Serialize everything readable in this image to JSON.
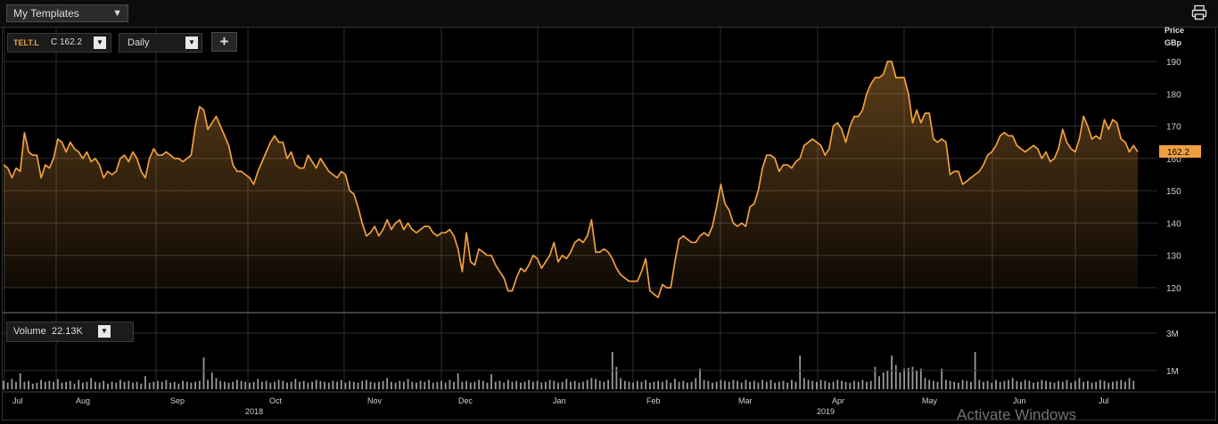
{
  "toolbar": {
    "template_label": "My Templates",
    "template_arrow": "▼"
  },
  "price_panel": {
    "symbol": "TELT.L",
    "close_label": "C 162.2",
    "interval": "Daily",
    "add_label": "+",
    "axis_title": "Price",
    "axis_unit": "GBp",
    "last_value_label": "162.2"
  },
  "volume_panel": {
    "label": "Volume",
    "value": "22.13K"
  },
  "colors": {
    "line": "#f0a040",
    "volume_bar": "#9a9a9a",
    "grid": "#2e2e2e",
    "background": "#000000",
    "badge": "#f0a040"
  },
  "watermark": "Activate Windows",
  "chart_data": [
    {
      "type": "area",
      "series": [
        {
          "x_start": "2018-07-02",
          "frequency": "daily",
          "values": [
            158,
            157,
            154,
            157,
            156,
            168,
            162,
            161,
            161,
            154,
            158,
            157,
            160,
            166,
            165,
            162,
            165,
            163,
            162,
            160,
            162,
            159,
            160,
            158,
            154,
            156,
            155,
            156,
            160,
            161,
            159,
            162,
            160,
            156,
            154,
            160,
            163,
            161,
            161,
            162,
            161,
            160,
            160,
            159,
            160,
            161,
            170,
            176,
            175,
            169,
            171,
            173,
            170,
            167,
            164,
            158,
            156,
            156,
            155,
            154,
            152,
            156,
            159,
            162,
            165,
            167,
            165,
            165,
            160,
            162,
            158,
            157,
            157,
            161,
            159,
            157,
            160,
            158,
            156,
            155,
            154,
            156,
            155,
            150,
            149,
            145,
            140,
            136,
            137,
            139,
            136,
            138,
            141,
            138,
            140,
            141,
            138,
            140,
            138,
            137,
            138,
            139,
            139,
            137,
            136,
            137,
            137,
            138,
            136,
            132,
            125,
            137,
            128,
            127,
            132,
            131,
            130,
            130,
            127,
            125,
            123,
            119,
            119,
            123,
            126,
            125,
            127,
            130,
            129,
            126,
            128,
            130,
            134,
            128,
            130,
            129,
            131,
            134,
            135,
            134,
            136,
            141,
            131,
            131,
            132,
            131,
            129,
            126,
            124,
            123,
            122,
            122,
            122,
            125,
            129,
            119,
            118,
            117,
            121,
            120,
            120,
            128,
            135,
            136,
            135,
            134,
            134,
            136,
            137,
            136,
            139,
            145,
            152,
            146,
            144,
            140,
            139,
            140,
            139,
            145,
            146,
            150,
            157,
            161,
            161,
            160,
            156,
            158,
            158,
            157,
            159,
            160,
            164,
            165,
            166,
            165,
            164,
            161,
            163,
            170,
            171,
            169,
            165,
            170,
            173,
            173,
            175,
            180,
            183,
            185,
            185,
            186,
            190,
            190,
            185,
            185,
            185,
            180,
            171,
            175,
            171,
            174,
            174,
            166,
            165,
            166,
            165,
            155,
            156,
            156,
            152,
            153,
            154,
            155,
            156,
            158,
            161,
            162,
            164,
            167,
            168,
            167,
            167,
            164,
            163,
            162,
            163,
            164,
            163,
            160,
            162,
            159,
            160,
            163,
            169,
            165,
            163,
            162,
            166,
            173,
            170,
            166,
            167,
            166,
            172,
            169,
            172,
            171,
            166,
            165,
            162,
            164,
            162
          ]
        }
      ],
      "xlabel": "",
      "ylabel": "Price GBp",
      "ylim": [
        113,
        200
      ],
      "yticks": [
        120,
        130,
        140,
        150,
        160,
        170,
        180,
        190
      ],
      "xticks": [
        "Jul",
        "Aug",
        "Sep",
        "Oct",
        "Nov",
        "Dec",
        "Jan",
        "Feb",
        "Mar",
        "Apr",
        "May",
        "Jun",
        "Jul"
      ],
      "year_labels": [
        "2018",
        "2019"
      ],
      "last_value": 162.2,
      "grid": true
    },
    {
      "type": "bar",
      "series": [
        {
          "name": "Volume",
          "values": [
            0.45,
            0.35,
            0.55,
            0.4,
            0.85,
            0.4,
            0.45,
            0.3,
            0.35,
            0.5,
            0.4,
            0.45,
            0.4,
            0.55,
            0.35,
            0.4,
            0.45,
            0.3,
            0.5,
            0.35,
            0.4,
            0.6,
            0.4,
            0.35,
            0.45,
            0.3,
            0.4,
            0.35,
            0.5,
            0.4,
            0.45,
            0.35,
            0.4,
            0.3,
            0.7,
            0.35,
            0.4,
            0.45,
            0.4,
            0.5,
            0.35,
            0.4,
            0.3,
            0.45,
            0.4,
            0.35,
            0.4,
            0.45,
            1.7,
            0.5,
            0.9,
            0.6,
            0.45,
            0.4,
            0.35,
            0.4,
            0.5,
            0.45,
            0.4,
            0.35,
            0.4,
            0.55,
            0.4,
            0.45,
            0.35,
            0.4,
            0.5,
            0.45,
            0.35,
            0.4,
            0.55,
            0.4,
            0.45,
            0.35,
            0.4,
            0.5,
            0.45,
            0.4,
            0.35,
            0.45,
            0.4,
            0.5,
            0.35,
            0.45,
            0.4,
            0.35,
            0.45,
            0.5,
            0.4,
            0.35,
            0.4,
            0.45,
            0.6,
            0.4,
            0.35,
            0.45,
            0.4,
            0.55,
            0.4,
            0.35,
            0.45,
            0.4,
            0.5,
            0.35,
            0.4,
            0.45,
            0.35,
            0.5,
            0.4,
            0.85,
            0.4,
            0.45,
            0.35,
            0.4,
            0.5,
            0.45,
            0.35,
            0.8,
            0.4,
            0.45,
            0.35,
            0.5,
            0.4,
            0.45,
            0.35,
            0.4,
            0.5,
            0.4,
            0.45,
            0.35,
            0.4,
            0.5,
            0.45,
            0.35,
            0.4,
            0.55,
            0.4,
            0.45,
            0.35,
            0.4,
            0.5,
            0.6,
            0.55,
            0.45,
            0.4,
            0.5,
            2.0,
            1.2,
            0.6,
            0.45,
            0.4,
            0.35,
            0.45,
            0.4,
            0.5,
            0.35,
            0.4,
            0.45,
            0.4,
            0.5,
            0.35,
            0.55,
            0.4,
            0.45,
            0.35,
            0.4,
            0.6,
            1.1,
            0.5,
            0.45,
            0.35,
            0.4,
            0.5,
            0.45,
            0.4,
            0.5,
            0.45,
            0.35,
            0.5,
            0.4,
            0.45,
            0.35,
            0.5,
            0.4,
            0.5,
            0.35,
            0.4,
            0.45,
            0.35,
            0.5,
            0.4,
            1.8,
            0.6,
            0.5,
            0.45,
            0.4,
            0.5,
            0.45,
            0.35,
            0.4,
            0.5,
            0.45,
            0.4,
            0.35,
            0.45,
            0.4,
            0.5,
            0.4,
            0.45,
            1.2,
            0.7,
            0.9,
            1.0,
            1.8,
            1.3,
            0.9,
            1.1,
            1.15,
            1.2,
            1.0,
            1.1,
            0.6,
            0.5,
            0.45,
            0.4,
            1.1,
            0.5,
            0.45,
            0.4,
            0.35,
            0.5,
            0.45,
            0.4,
            2.0,
            0.5,
            0.4,
            0.45,
            0.35,
            0.5,
            0.4,
            0.45,
            0.5,
            0.6,
            0.45,
            0.4,
            0.5,
            0.45,
            0.35,
            0.4,
            0.5,
            0.45,
            0.4,
            0.35,
            0.45,
            0.4,
            0.5,
            0.35,
            0.45,
            0.6,
            0.4,
            0.45,
            0.35,
            0.4,
            0.5,
            0.45,
            0.35,
            0.4,
            0.45,
            0.5,
            0.4,
            0.6,
            0.45
          ]
        }
      ],
      "ylim": [
        0,
        3.4
      ],
      "yticks": [
        "1M",
        "3M"
      ],
      "ytick_values": [
        1,
        3
      ]
    }
  ]
}
